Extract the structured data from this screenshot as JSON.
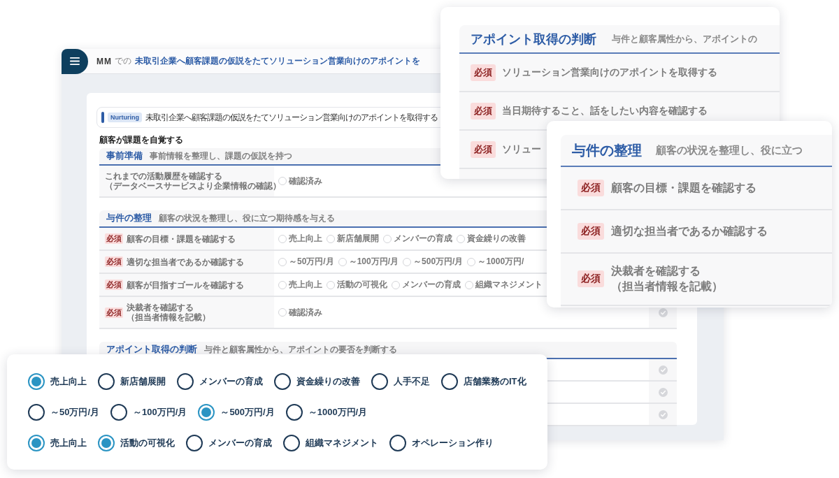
{
  "main_window": {
    "header": {
      "owner": "MM",
      "particle": "での",
      "title": "未取引企業へ顧客課題の仮説をたてソリューション営業向けのアポイントを"
    },
    "banner": {
      "tag": "Nurturing",
      "text": "未取引企業へ顧客課題の仮説をたてソリューション営業向けのアポイントを取得する"
    },
    "stage": "顧客が課題を自覚する",
    "sections": [
      {
        "title": "事前準備",
        "description": "事前情報を整理し、課題の仮説を持つ",
        "rows": [
          {
            "label_lines": [
              "これまでの活動履歴を確認する",
              "（データベースサービスより企業情報の確認）"
            ],
            "options": [
              {
                "label": "確認済み",
                "selected": false
              }
            ]
          }
        ]
      },
      {
        "title": "与件の整理",
        "description": "顧客の状況を整理し、役に立つ期待感を与える",
        "rows": [
          {
            "badge": "必須",
            "label_lines": [
              "顧客の目標・課題を確認する"
            ],
            "options": [
              {
                "label": "売上向上",
                "selected": false
              },
              {
                "label": "新店舗展開",
                "selected": false
              },
              {
                "label": "メンバーの育成",
                "selected": false
              },
              {
                "label": "資金繰りの改善",
                "selected": false
              }
            ]
          },
          {
            "badge": "必須",
            "label_lines": [
              "適切な担当者であるか確認する"
            ],
            "options": [
              {
                "label": "～50万円/月",
                "selected": false
              },
              {
                "label": "～100万円/月",
                "selected": false
              },
              {
                "label": "～500万円/月",
                "selected": false
              },
              {
                "label": "～1000万円/",
                "selected": false
              }
            ]
          },
          {
            "badge": "必須",
            "label_lines": [
              "顧客が目指すゴールを確認する"
            ],
            "options": [
              {
                "label": "売上向上",
                "selected": false
              },
              {
                "label": "活動の可視化",
                "selected": false
              },
              {
                "label": "メンバーの育成",
                "selected": false
              },
              {
                "label": "組織マネジメント",
                "selected": false
              }
            ]
          },
          {
            "badge": "必須",
            "label_lines": [
              "決裁者を確認する",
              "（担当者情報を記載）"
            ],
            "options": [
              {
                "label": "確認済み",
                "selected": false
              }
            ],
            "done": false
          }
        ]
      },
      {
        "title": "アポイント取得の判断",
        "description": "与件と顧客属性から、アポイントの要否を判断する",
        "rows": [
          {
            "done": false
          },
          {
            "done": false
          },
          {
            "done": false
          }
        ]
      }
    ]
  },
  "cards": [
    {
      "title": "アポイント取得の判断",
      "description": "与件と顧客属性から、アポイントの",
      "rows": [
        {
          "badge": "必須",
          "label_lines": [
            "ソリューション営業向けのアポイントを取得する"
          ]
        },
        {
          "badge": "必須",
          "label_lines": [
            "当日期待すること、話をしたい内容を確認する"
          ]
        },
        {
          "badge": "必須",
          "label_lines": [
            "ソリュー"
          ]
        }
      ]
    },
    {
      "title": "与件の整理",
      "description": "顧客の状況を整理し、役に立つ",
      "rows": [
        {
          "badge": "必須",
          "label_lines": [
            "顧客の目標・課題を確認する"
          ]
        },
        {
          "badge": "必須",
          "label_lines": [
            "適切な担当者であるか確認する"
          ]
        },
        {
          "badge": "必須",
          "label_lines": [
            "決裁者を確認する",
            "（担当者情報を記載）"
          ]
        }
      ]
    }
  ],
  "answer_card": {
    "groups": [
      {
        "options": [
          {
            "label": "売上向上",
            "selected": true
          },
          {
            "label": "新店舗展開",
            "selected": false
          },
          {
            "label": "メンバーの育成",
            "selected": false
          },
          {
            "label": "資金繰りの改善",
            "selected": false
          },
          {
            "label": "人手不足",
            "selected": false
          },
          {
            "label": "店舗業務のIT化",
            "selected": false
          }
        ]
      },
      {
        "options": [
          {
            "label": "～50万円/月",
            "selected": false
          },
          {
            "label": "～100万円/月",
            "selected": false
          },
          {
            "label": "～500万円/月",
            "selected": true
          },
          {
            "label": "～1000万円/月",
            "selected": false
          }
        ]
      },
      {
        "options": [
          {
            "label": "売上向上",
            "selected": true
          },
          {
            "label": "活動の可視化",
            "selected": true
          },
          {
            "label": "メンバーの育成",
            "selected": false
          },
          {
            "label": "組織マネジメント",
            "selected": false
          },
          {
            "label": "オペレーション作り",
            "selected": false
          }
        ]
      }
    ]
  }
}
